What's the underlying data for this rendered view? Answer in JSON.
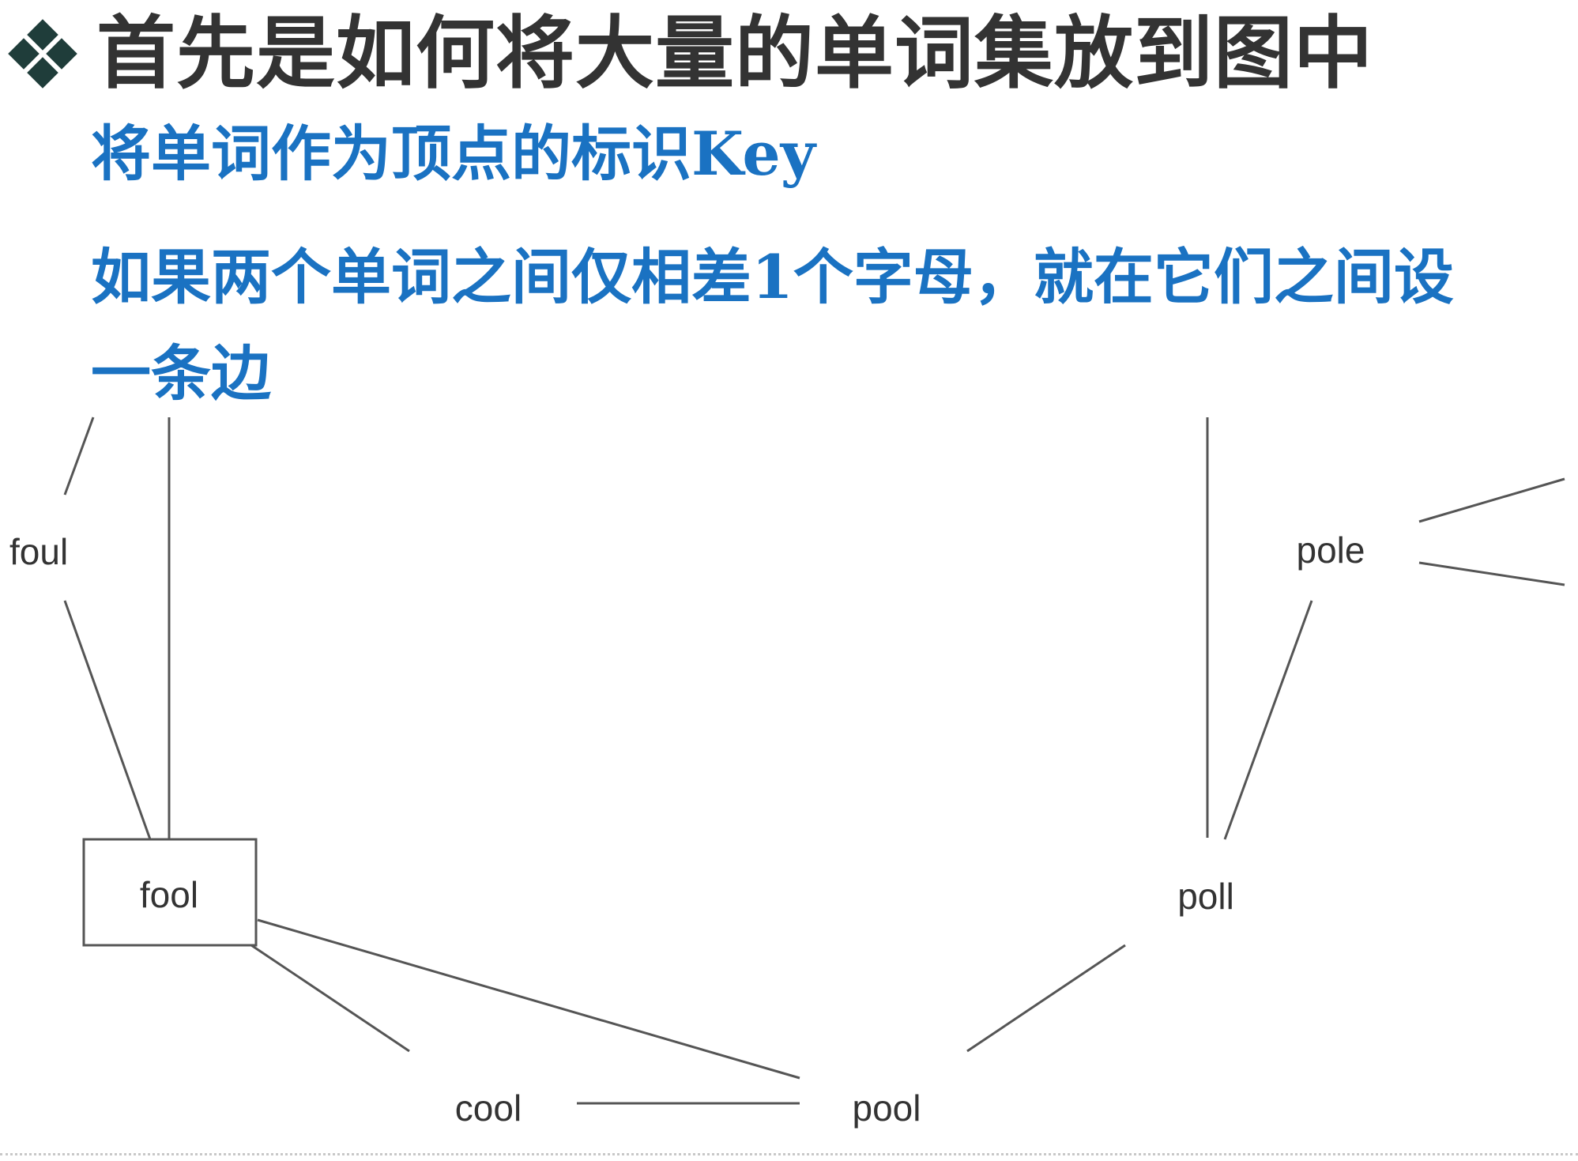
{
  "title": "首先是如何将大量的单词集放到图中",
  "line1": "将单词作为顶点的标识Key",
  "paragraph": "如果两个单词之间仅相差1个字母，就在它们之间设一条边",
  "nodes": [
    {
      "id": "foul",
      "label": "foul"
    },
    {
      "id": "fool",
      "label": "fool",
      "boxed": true
    },
    {
      "id": "cool",
      "label": "cool"
    },
    {
      "id": "pool",
      "label": "pool"
    },
    {
      "id": "poll",
      "label": "poll"
    },
    {
      "id": "pole",
      "label": "pole"
    }
  ],
  "edges": [
    [
      "foul",
      "fool"
    ],
    [
      "fool",
      "cool"
    ],
    [
      "fool",
      "pool"
    ],
    [
      "cool",
      "pool"
    ],
    [
      "pool",
      "poll"
    ],
    [
      "poll",
      "pole"
    ]
  ],
  "colors": {
    "title": "#333333",
    "body_text": "#1a72c2",
    "lines": "#555555"
  }
}
